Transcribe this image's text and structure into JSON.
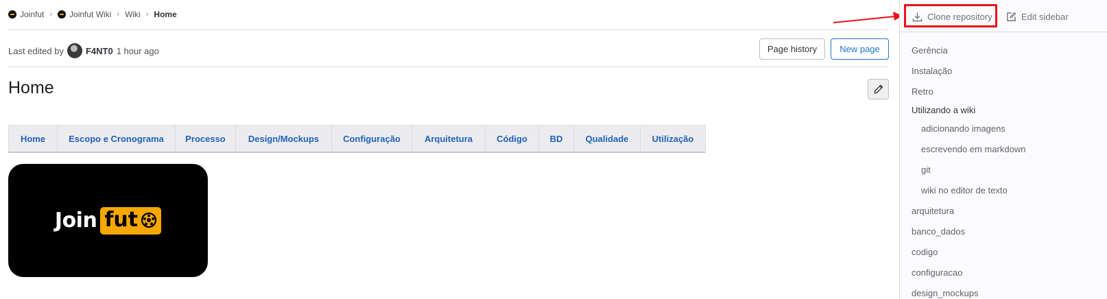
{
  "breadcrumb": {
    "items": [
      "Joinfut",
      "Joinfut Wiki",
      "Wiki"
    ],
    "current": "Home"
  },
  "edited": {
    "prefix": "Last edited by",
    "author": "F4NT0",
    "time": "1 hour ago"
  },
  "buttons": {
    "history": "Page history",
    "new_page": "New page"
  },
  "page": {
    "title": "Home"
  },
  "nav_table": [
    "Home",
    "Escopo e Cronograma",
    "Processo",
    "Design/Mockups",
    "Configuração",
    "Arquitetura",
    "Código",
    "BD",
    "Qualidade",
    "Utilização"
  ],
  "logo": {
    "text_join": "Join",
    "text_fut": "fut"
  },
  "sidebar": {
    "clone": "Clone repository",
    "edit": "Edit sidebar",
    "items": [
      {
        "label": "Gerência",
        "level": 0
      },
      {
        "label": "Instalação",
        "level": 0
      },
      {
        "label": "Retro",
        "level": 0
      },
      {
        "label": "Utilizando a wiki",
        "level": 0,
        "active": true
      },
      {
        "label": "adicionando imagens",
        "level": 1
      },
      {
        "label": "escrevendo em markdown",
        "level": 1
      },
      {
        "label": "git",
        "level": 1
      },
      {
        "label": "wiki no editor de texto",
        "level": 1
      },
      {
        "label": "arquitetura",
        "level": 0
      },
      {
        "label": "banco_dados",
        "level": 0
      },
      {
        "label": "codigo",
        "level": 0
      },
      {
        "label": "configuracao",
        "level": 0
      },
      {
        "label": "design_mockups",
        "level": 0
      }
    ]
  },
  "colors": {
    "link": "#1f62b8",
    "accent": "#1f75cb",
    "annotation": "#e8141b",
    "logo_accent": "#f7a800"
  },
  "icons": [
    "joinfut-logo-icon",
    "chevron-right-icon",
    "pencil-icon",
    "download-icon",
    "edit-square-icon",
    "soccer-ball-icon"
  ]
}
